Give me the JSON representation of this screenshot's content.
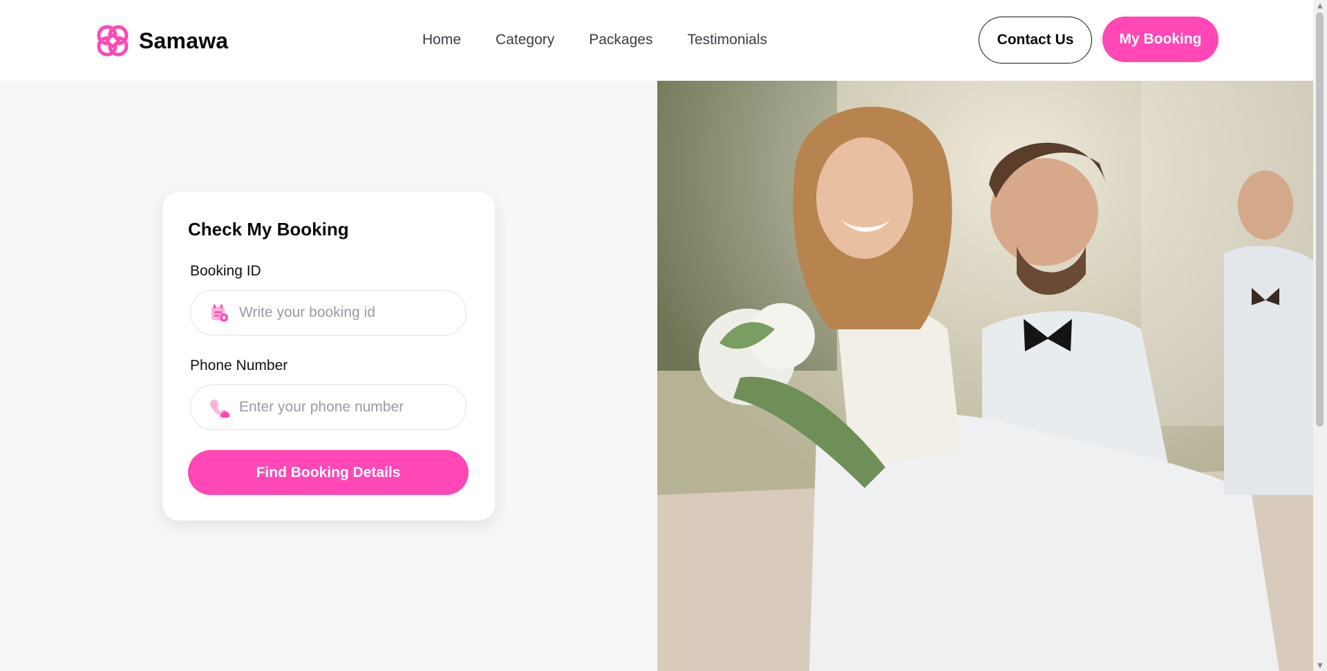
{
  "brand": {
    "name": "Samawa",
    "accent": "#ff47b5"
  },
  "nav": {
    "items": [
      {
        "label": "Home"
      },
      {
        "label": "Category"
      },
      {
        "label": "Packages"
      },
      {
        "label": "Testimonials"
      }
    ]
  },
  "header": {
    "contact_label": "Contact Us",
    "my_booking_label": "My Booking"
  },
  "booking_form": {
    "title": "Check My Booking",
    "booking_id": {
      "label": "Booking ID",
      "placeholder": "Write your booking id",
      "value": "",
      "icon": "calendar-icon"
    },
    "phone": {
      "label": "Phone Number",
      "placeholder": "Enter your phone number",
      "value": "",
      "icon": "phone-icon"
    },
    "submit_label": "Find Booking Details"
  },
  "hero": {
    "image": "wedding-couple-photo"
  }
}
